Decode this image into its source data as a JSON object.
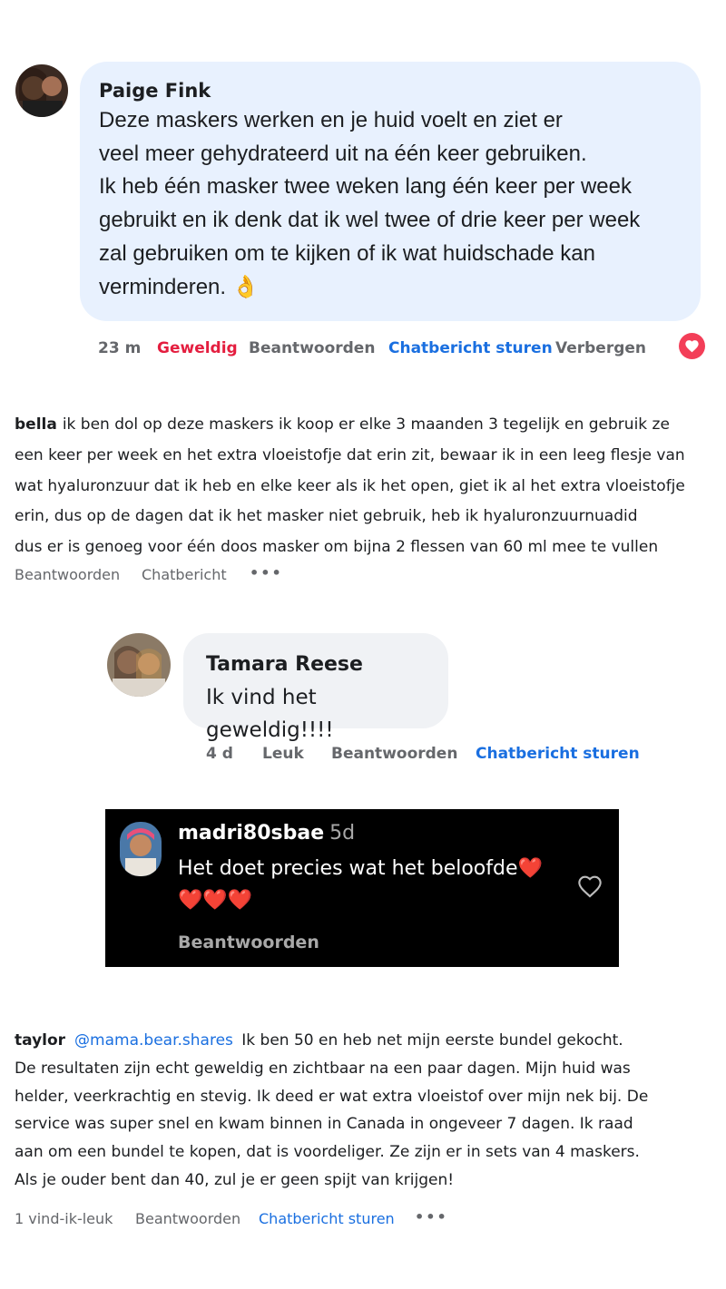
{
  "comment1": {
    "author": "Paige Fink",
    "lines": [
      "Deze maskers werken en je huid voelt en ziet er",
      "veel meer gehydrateerd uit na één keer gebruiken.",
      "Ik heb één masker twee weken lang één keer per week",
      "gebruikt en ik denk dat ik wel twee of drie keer per week",
      "zal gebruiken om te kijken of ik wat huidschade kan",
      "verminderen. 👌"
    ],
    "time": "23 m",
    "reaction_label": "Geweldig",
    "reply_label": "Beantwoorden",
    "chat_label": "Chatbericht sturen",
    "hide_label": "Verbergen",
    "reaction_icon": "heart-icon",
    "reaction_color": "#f33e58"
  },
  "comment2": {
    "author": "bella",
    "first_line": "ik ben dol op deze maskers ik koop er elke 3 maanden 3 tegelijk en gebruik ze",
    "lines": [
      "een keer per week en het extra vloeistofje dat erin zit, bewaar ik in een leeg flesje van",
      "wat hyaluronzuur dat ik heb en elke keer als ik het open, giet ik al het extra vloeistofje",
      "erin, dus op de dagen dat ik het masker niet gebruik, heb ik hyaluronzuurnuadid",
      "dus er is genoeg voor één doos masker om bijna 2 flessen van 60 ml mee te vullen"
    ],
    "reply_label": "Beantwoorden",
    "chat_label": "Chatbericht",
    "more_label": "•••"
  },
  "comment3": {
    "author": "Tamara Reese",
    "text": "Ik vind het geweldig!!!!",
    "time": "4 d",
    "like_label": "Leuk",
    "reply_label": "Beantwoorden",
    "chat_label": "Chatbericht sturen"
  },
  "comment4": {
    "author": "madri80sbae",
    "time": "5d",
    "line1": "Het doet precies wat het beloofde",
    "hearts_inline": "❤️",
    "hearts_line2": "❤️❤️❤️",
    "reply_label": "Beantwoorden",
    "like_icon": "heart-outline-icon"
  },
  "comment5": {
    "author": "taylor",
    "mention": "@mama.bear.shares",
    "first_line": "Ik ben 50 en heb net mijn eerste bundel gekocht.",
    "lines": [
      "De resultaten zijn echt geweldig en zichtbaar na een paar dagen. Mijn huid was",
      "helder, veerkrachtig en stevig. Ik deed er wat extra vloeistof over mijn nek bij. De",
      "service was super snel en kwam binnen in Canada in ongeveer 7 dagen. Ik raad",
      "aan om een bundel te kopen, dat is voordeliger. Ze zijn er in sets van 4 maskers.",
      "Als je ouder bent dan 40, zul je er geen spijt van krijgen!"
    ],
    "likes_label": "1 vind-ik-leuk",
    "reply_label": "Beantwoorden",
    "chat_label": "Chatbericht sturen",
    "more_label": "•••"
  }
}
